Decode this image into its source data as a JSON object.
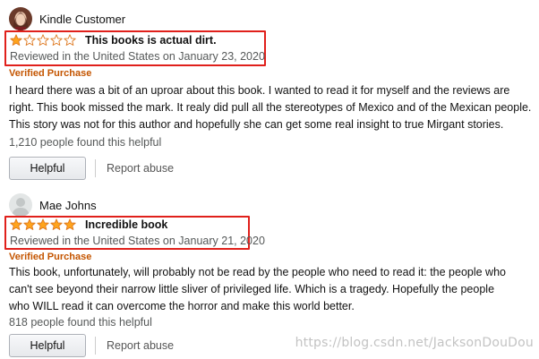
{
  "reviews": [
    {
      "author": "Kindle Customer",
      "rating": 1,
      "rating_max": 5,
      "title": "This books is actual dirt.",
      "date": "Reviewed in the United States on January 23, 2020",
      "verified": "Verified Purchase",
      "body": "I heard there was a bit of an uproar about this book. I wanted to read it for myself and the reviews are right. This book missed the mark. It realy did pull all the stereotypes of Mexico and of the Mexican people. This story was not for this author and hopefully she can get some real insight to true Mirgant stories.",
      "helpful_count": "1,210 people found this helpful",
      "helpful_label": "Helpful",
      "report_label": "Report abuse"
    },
    {
      "author": "Mae Johns",
      "rating": 5,
      "rating_max": 5,
      "title": "Incredible book",
      "date": "Reviewed in the United States on January 21, 2020",
      "verified": "Verified Purchase",
      "body": "This book, unfortunately, will probably not be read by the people who need to read it: the people who can't see beyond their narrow little sliver of privileged life. Which is a tragedy. Hopefully the people who WILL read it can overcome the horror and make this world better.",
      "helpful_count": "818 people found this helpful",
      "helpful_label": "Helpful",
      "report_label": "Report abuse"
    }
  ],
  "watermark": "https://blog.csdn.net/JacksonDouDou",
  "colors": {
    "highlight": "#e0201b",
    "star_fill": "#ffa41c",
    "star_stroke": "#de7921",
    "verified": "#c45500",
    "muted_text": "#565959"
  },
  "icons": {
    "review_1_avatar": "user-photo-avatar",
    "review_2_avatar": "default-user-avatar",
    "rating": "star-icon"
  }
}
